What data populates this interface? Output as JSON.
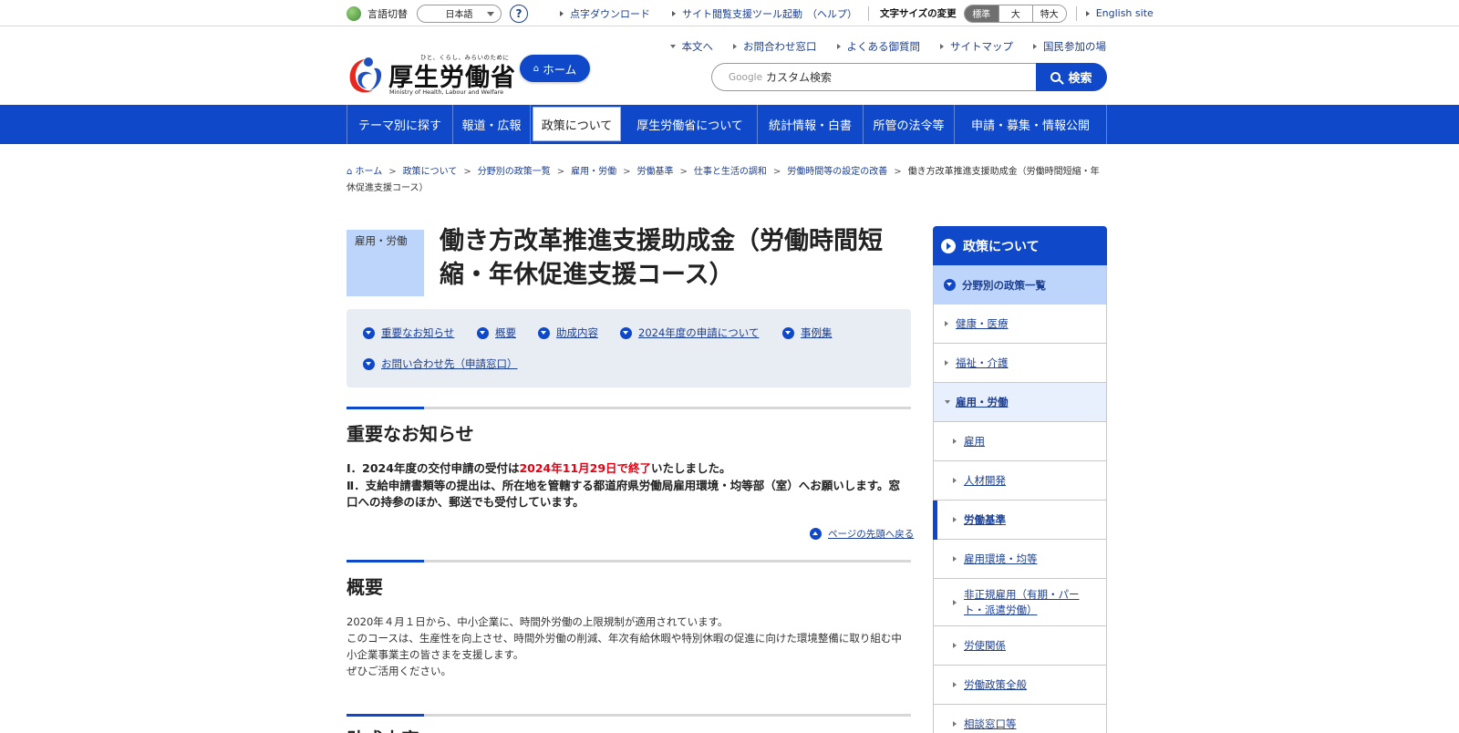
{
  "utility": {
    "lang_label": "言語切替",
    "lang_value": "日本語",
    "help": "?",
    "links": [
      "点字ダウンロード",
      "サイト閲覧支援ツール起動",
      "（ヘルプ）"
    ],
    "font_size_label": "文字サイズの変更",
    "font_sizes": [
      "標準",
      "大",
      "特大"
    ],
    "english": "English site"
  },
  "header": {
    "logo_tagline": "ひと、くらし、みらいのために",
    "logo_name": "厚生労働省",
    "logo_en": "Ministry of Health, Labour and Welfare",
    "home_button": "ホーム",
    "links": [
      "本文へ",
      "お問合わせ窓口",
      "よくある御質問",
      "サイトマップ",
      "国民参加の場"
    ],
    "search_brand": "Google",
    "search_placeholder": "カスタム検索",
    "search_button": "検索"
  },
  "gnav": [
    "テーマ別に探す",
    "報道・広報",
    "政策について",
    "厚生労働省について",
    "統計情報・白書",
    "所管の法令等",
    "申請・募集・情報公開"
  ],
  "breadcrumb": {
    "links": [
      "ホーム",
      "政策について",
      "分野別の政策一覧",
      "雇用・労働",
      "労働基準",
      "仕事と生活の調和",
      "労働時間等の設定の改善"
    ],
    "current": "働き方改革推進支援助成金（労働時間短縮・年休促進支援コース）"
  },
  "page": {
    "category": "雇用・労働",
    "title": "働き方改革推進支援助成金（労働時間短縮・年休促進支援コース）",
    "anchors": [
      "重要なお知らせ",
      "概要",
      "助成内容",
      "2024年度の申請について",
      "事例集",
      "お問い合わせ先（申請窓口）"
    ]
  },
  "notice": {
    "heading": "重要なお知らせ",
    "line1_pre": "Ⅰ．2024年度の交付申請の受付は",
    "line1_red": "2024年11月29日で終了",
    "line1_post": "いたしました。",
    "line2": "Ⅱ．支給申請書類等の提出は、所在地を管轄する都道府県労働局雇用環境・均等部（室）へお願いします。窓口への持参のほか、郵送でも受付しています。",
    "pagetop": "ページの先頭へ戻る"
  },
  "overview": {
    "heading": "概要",
    "lines": [
      "2020年４月１日から、中小企業に、時間外労働の上限規制が適用されています。",
      "このコースは、生産性を向上させ、時間外労働の削減、年次有給休暇や特別休暇の促進に向けた環境整備に取り組む中小企業事業主の皆さまを支援します。",
      "ぜひご活用ください。"
    ]
  },
  "next_heading": "助成内容",
  "sidebar": {
    "title": "政策について",
    "sub": "分野別の政策一覧",
    "items": [
      "健康・医療",
      "福祉・介護",
      "雇用・労働",
      "雇用",
      "人材開発",
      "労働基準",
      "雇用環境・均等",
      "非正規雇用（有期・パート・派遣労働）",
      "労使関係",
      "労働政策全般",
      "相談窓口等"
    ]
  },
  "colors": {
    "brand_blue": "#0f48c8",
    "notice_red": "#e60012",
    "category_bg": "#bdd4fb"
  }
}
